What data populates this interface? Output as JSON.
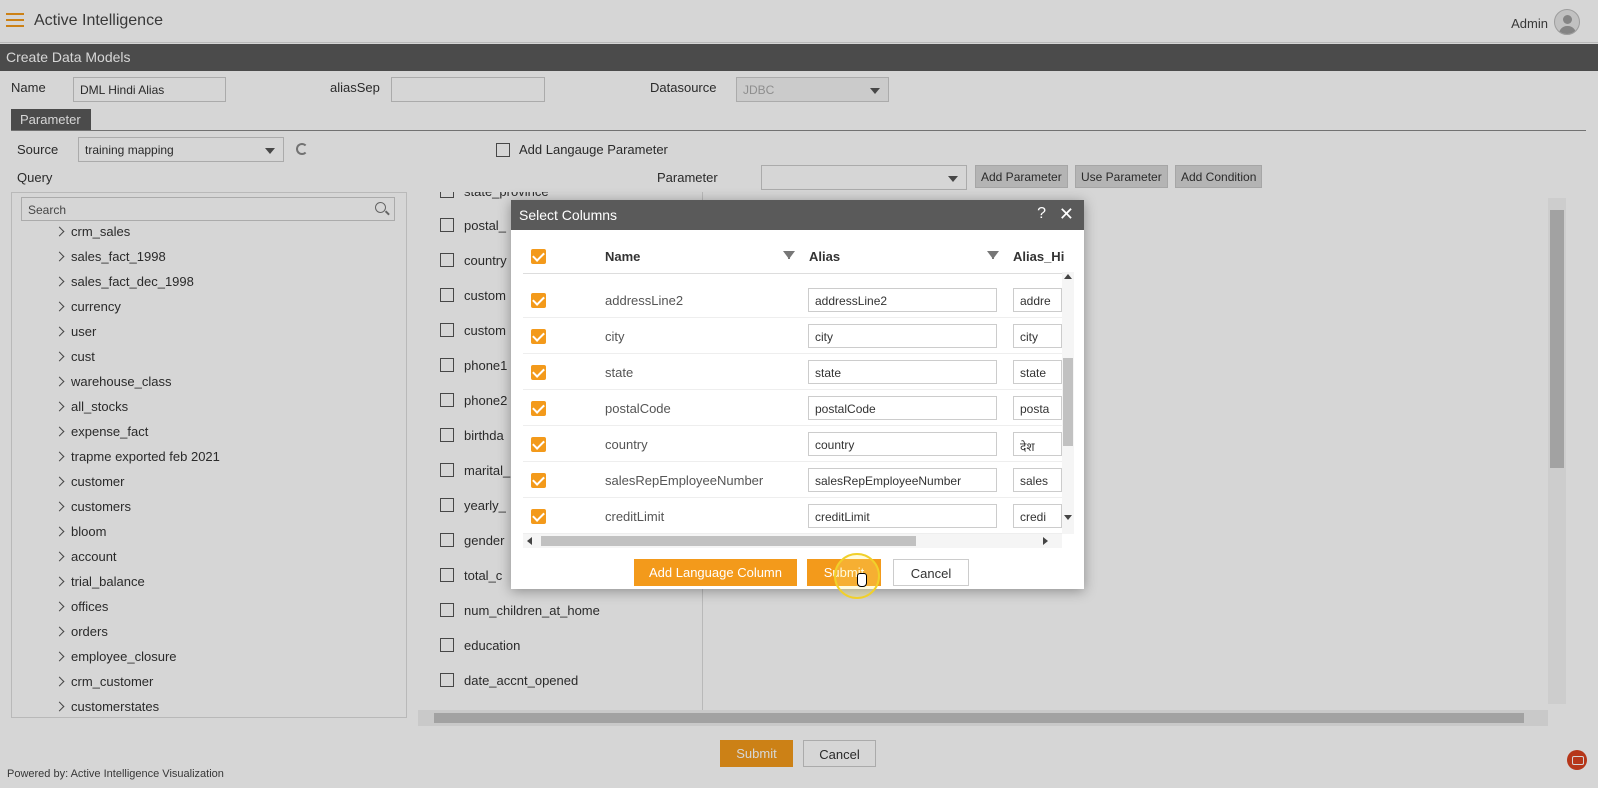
{
  "app": {
    "title": "Active Intelligence",
    "user": "Admin",
    "accent": "#f39a1b"
  },
  "section": {
    "title": "Create Data Models"
  },
  "form": {
    "name_label": "Name",
    "name_value": "DML Hindi Alias",
    "aliassep_label": "aliasSep",
    "aliassep_value": "",
    "datasource_label": "Datasource",
    "datasource_value": "JDBC",
    "parameter_tab": "Parameter",
    "source_label": "Source",
    "source_value": "training mapping",
    "add_language_param": "Add Langauge Parameter",
    "query_label": "Query",
    "parameter_label": "Parameter",
    "parameter_value": "",
    "add_parameter": "Add Parameter",
    "use_parameter": "Use Parameter",
    "add_condition": "Add Condition"
  },
  "tree": {
    "search_placeholder": "Search",
    "items": [
      "crm_sales",
      "sales_fact_1998",
      "sales_fact_dec_1998",
      "currency",
      "user",
      "cust",
      "warehouse_class",
      "all_stocks",
      "expense_fact",
      "trapme exported feb 2021",
      "customer",
      "customers",
      "bloom",
      "account",
      "trial_balance",
      "offices",
      "orders",
      "employee_closure",
      "crm_customer",
      "customerstates"
    ]
  },
  "columns": {
    "items": [
      "state_province",
      "postal_",
      "country",
      "custom",
      "custom",
      "phone1",
      "phone2",
      "birthda",
      "marital_",
      "yearly_",
      "gender",
      "total_c",
      "num_children_at_home",
      "education",
      "date_accnt_opened"
    ]
  },
  "page_buttons": {
    "submit": "Submit",
    "cancel": "Cancel"
  },
  "footer": {
    "powered_by": "Powered by: Active Intelligence Visualization"
  },
  "modal": {
    "title": "Select Columns",
    "help": "?",
    "close": "✕",
    "headers": {
      "name": "Name",
      "alias": "Alias",
      "alias_hindi": "Alias_Hi"
    },
    "rows": [
      {
        "name": "addressLine2",
        "alias": "addressLine2",
        "alias_hindi": "addre"
      },
      {
        "name": "city",
        "alias": "city",
        "alias_hindi": "city"
      },
      {
        "name": "state",
        "alias": "state",
        "alias_hindi": "state"
      },
      {
        "name": "postalCode",
        "alias": "postalCode",
        "alias_hindi": "posta"
      },
      {
        "name": "country",
        "alias": "country",
        "alias_hindi": "देश"
      },
      {
        "name": "salesRepEmployeeNumber",
        "alias": "salesRepEmployeeNumber",
        "alias_hindi": "sales"
      },
      {
        "name": "creditLimit",
        "alias": "creditLimit",
        "alias_hindi": "credi"
      }
    ],
    "add_language_column": "Add Language Column",
    "submit": "Submit",
    "cancel": "Cancel"
  }
}
